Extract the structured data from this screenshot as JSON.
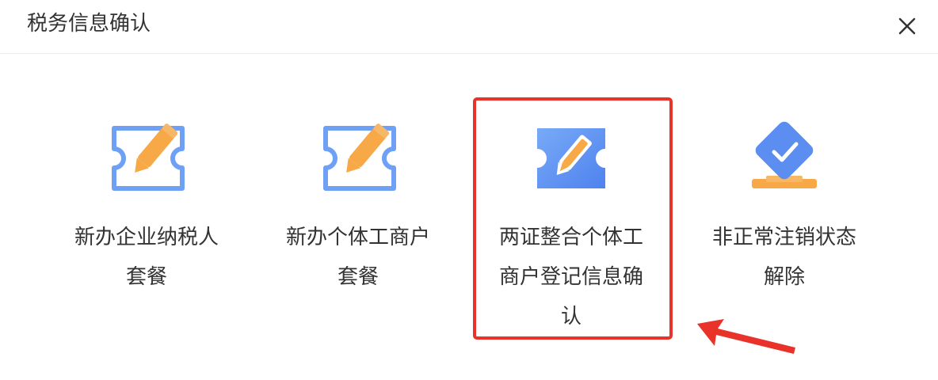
{
  "dialog": {
    "title": "税务信息确认",
    "close_icon": "close-icon"
  },
  "cards": [
    {
      "label_line1": "新办企业纳税人",
      "label_line2": "套餐",
      "label_line3": "",
      "icon": "edit-pencil-icon"
    },
    {
      "label_line1": "新办个体工商户",
      "label_line2": "套餐",
      "label_line3": "",
      "icon": "edit-pencil-icon"
    },
    {
      "label_line1": "两证整合个体工",
      "label_line2": "商户登记信息确",
      "label_line3": "认",
      "icon": "ticket-pencil-icon"
    },
    {
      "label_line1": "非正常注销状态",
      "label_line2": "解除",
      "label_line3": "",
      "icon": "vote-check-icon"
    }
  ],
  "colors": {
    "accent_blue": "#5b8ef0",
    "accent_orange": "#f7a847",
    "highlight_red": "#e8322a"
  }
}
